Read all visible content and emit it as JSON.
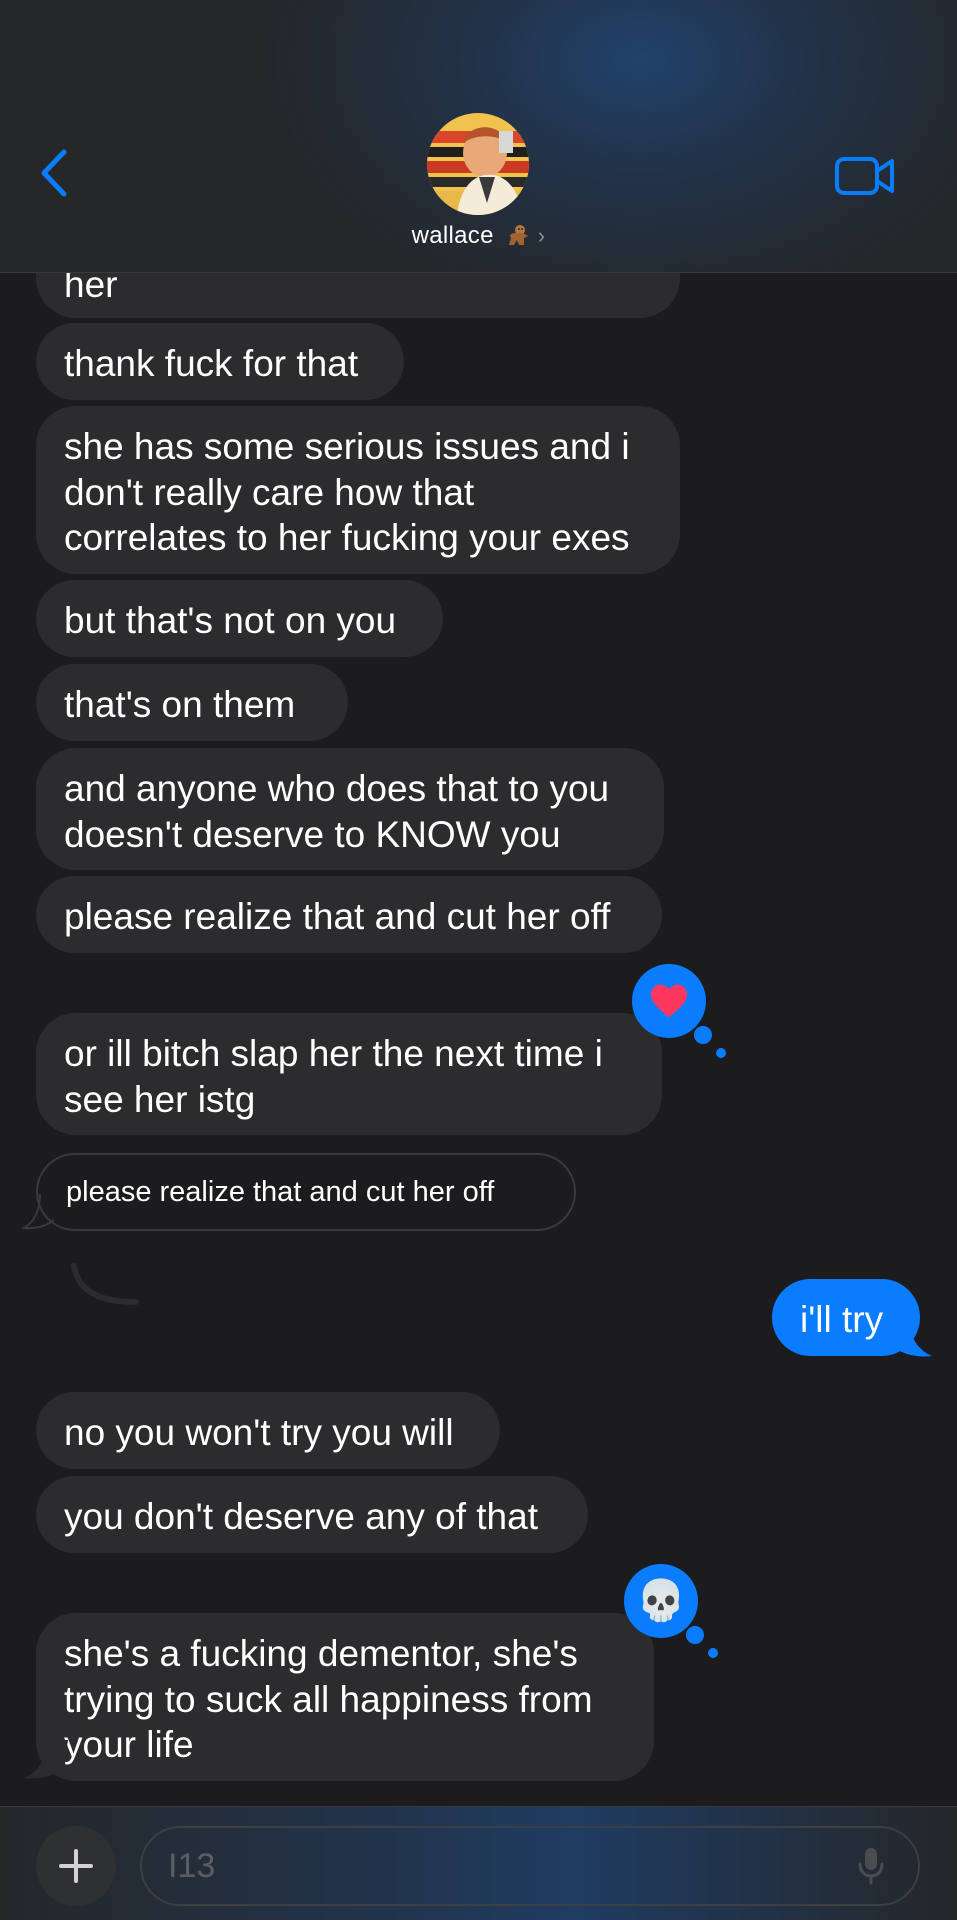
{
  "header": {
    "back_icon": "chevron-left-icon",
    "contact_name": "wallace",
    "contact_emoji": "gingerbread-emoji",
    "video_icon": "video-camera-icon",
    "accent_color": "#0a7cff"
  },
  "messages": [
    {
      "side": "received",
      "text": "her"
    },
    {
      "side": "received",
      "text": "thank fuck for that"
    },
    {
      "side": "received",
      "text": "she has some serious issues and i\ndon't really care how that\ncorrelates to her fucking your exes"
    },
    {
      "side": "received",
      "text": "but that's not on you"
    },
    {
      "side": "received",
      "text": "that's on them"
    },
    {
      "side": "received",
      "text": "and anyone who does that to you\ndoesn't deserve to KNOW you"
    },
    {
      "side": "received",
      "text": "please realize that and cut her off"
    },
    {
      "side": "received",
      "text": "or ill bitch slap her the next time i\nsee her istg",
      "tapback": "heart-icon"
    },
    {
      "side": "received",
      "type": "reply-quote",
      "text": "please realize that and cut her off"
    },
    {
      "side": "sent",
      "text": "i'll try"
    },
    {
      "side": "received",
      "text": "no you won't try you will"
    },
    {
      "side": "received",
      "text": "you don't deserve any of that"
    },
    {
      "side": "received",
      "text": "she's a fucking dementor, she's\ntrying to suck all happiness from\nyour life",
      "tapback": "skull-emoji",
      "tapback_glyph": "💀"
    }
  ],
  "composer": {
    "plus_icon": "plus-icon",
    "placeholder": "I13",
    "mic_icon": "microphone-icon"
  },
  "colors": {
    "received_bubble": "#2c2c2e",
    "sent_bubble": "#0a7cff",
    "background": "#1c1c1e",
    "heart": "#ff375f"
  }
}
